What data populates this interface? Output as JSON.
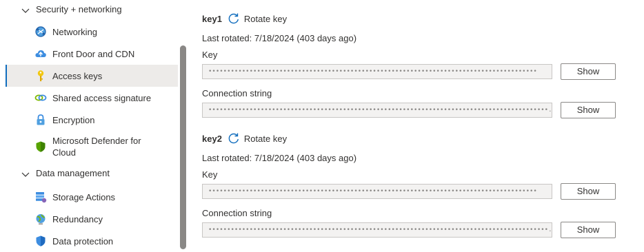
{
  "sidebar": {
    "groups": [
      {
        "label": "Security + networking"
      },
      {
        "label": "Data management"
      }
    ],
    "security_items": [
      {
        "label": "Networking",
        "icon": "networking-icon"
      },
      {
        "label": "Front Door and CDN",
        "icon": "cloud-icon"
      },
      {
        "label": "Access keys",
        "icon": "key-icon",
        "selected": true
      },
      {
        "label": "Shared access signature",
        "icon": "link-icon"
      },
      {
        "label": "Encryption",
        "icon": "lock-icon"
      },
      {
        "label": "Microsoft Defender for Cloud",
        "icon": "shield-icon"
      }
    ],
    "data_items": [
      {
        "label": "Storage Actions",
        "icon": "storage-actions-icon"
      },
      {
        "label": "Redundancy",
        "icon": "globe-icon"
      },
      {
        "label": "Data protection",
        "icon": "shield-icon"
      }
    ]
  },
  "keys": [
    {
      "name": "key1",
      "rotate_label": "Rotate key",
      "last_rotated": "Last rotated: 7/18/2024 (403 days ago)",
      "key_label": "Key",
      "key_value": "••••••••••••••••••••••••••••••••••••••••••••••••••••••••••••••••••••••••••••••••••••••••",
      "conn_label": "Connection string",
      "conn_value": "•••••••••••••••••••••••••••••••••••••••••••••••••••••••••••••••••••••••••••••••••••••••••••...",
      "show_label": "Show"
    },
    {
      "name": "key2",
      "rotate_label": "Rotate key",
      "last_rotated": "Last rotated: 7/18/2024 (403 days ago)",
      "key_label": "Key",
      "key_value": "••••••••••••••••••••••••••••••••••••••••••••••••••••••••••••••••••••••••••••••••••••••••",
      "conn_label": "Connection string",
      "conn_value": "•••••••••••••••••••••••••••••••••••••••••••••••••••••••••••••••••••••••••••••••••••••••••••...",
      "show_label": "Show"
    }
  ],
  "colors": {
    "accent": "#0f6cbd",
    "selected_bg": "#edebe9",
    "field_bg": "#f3f2f1"
  }
}
